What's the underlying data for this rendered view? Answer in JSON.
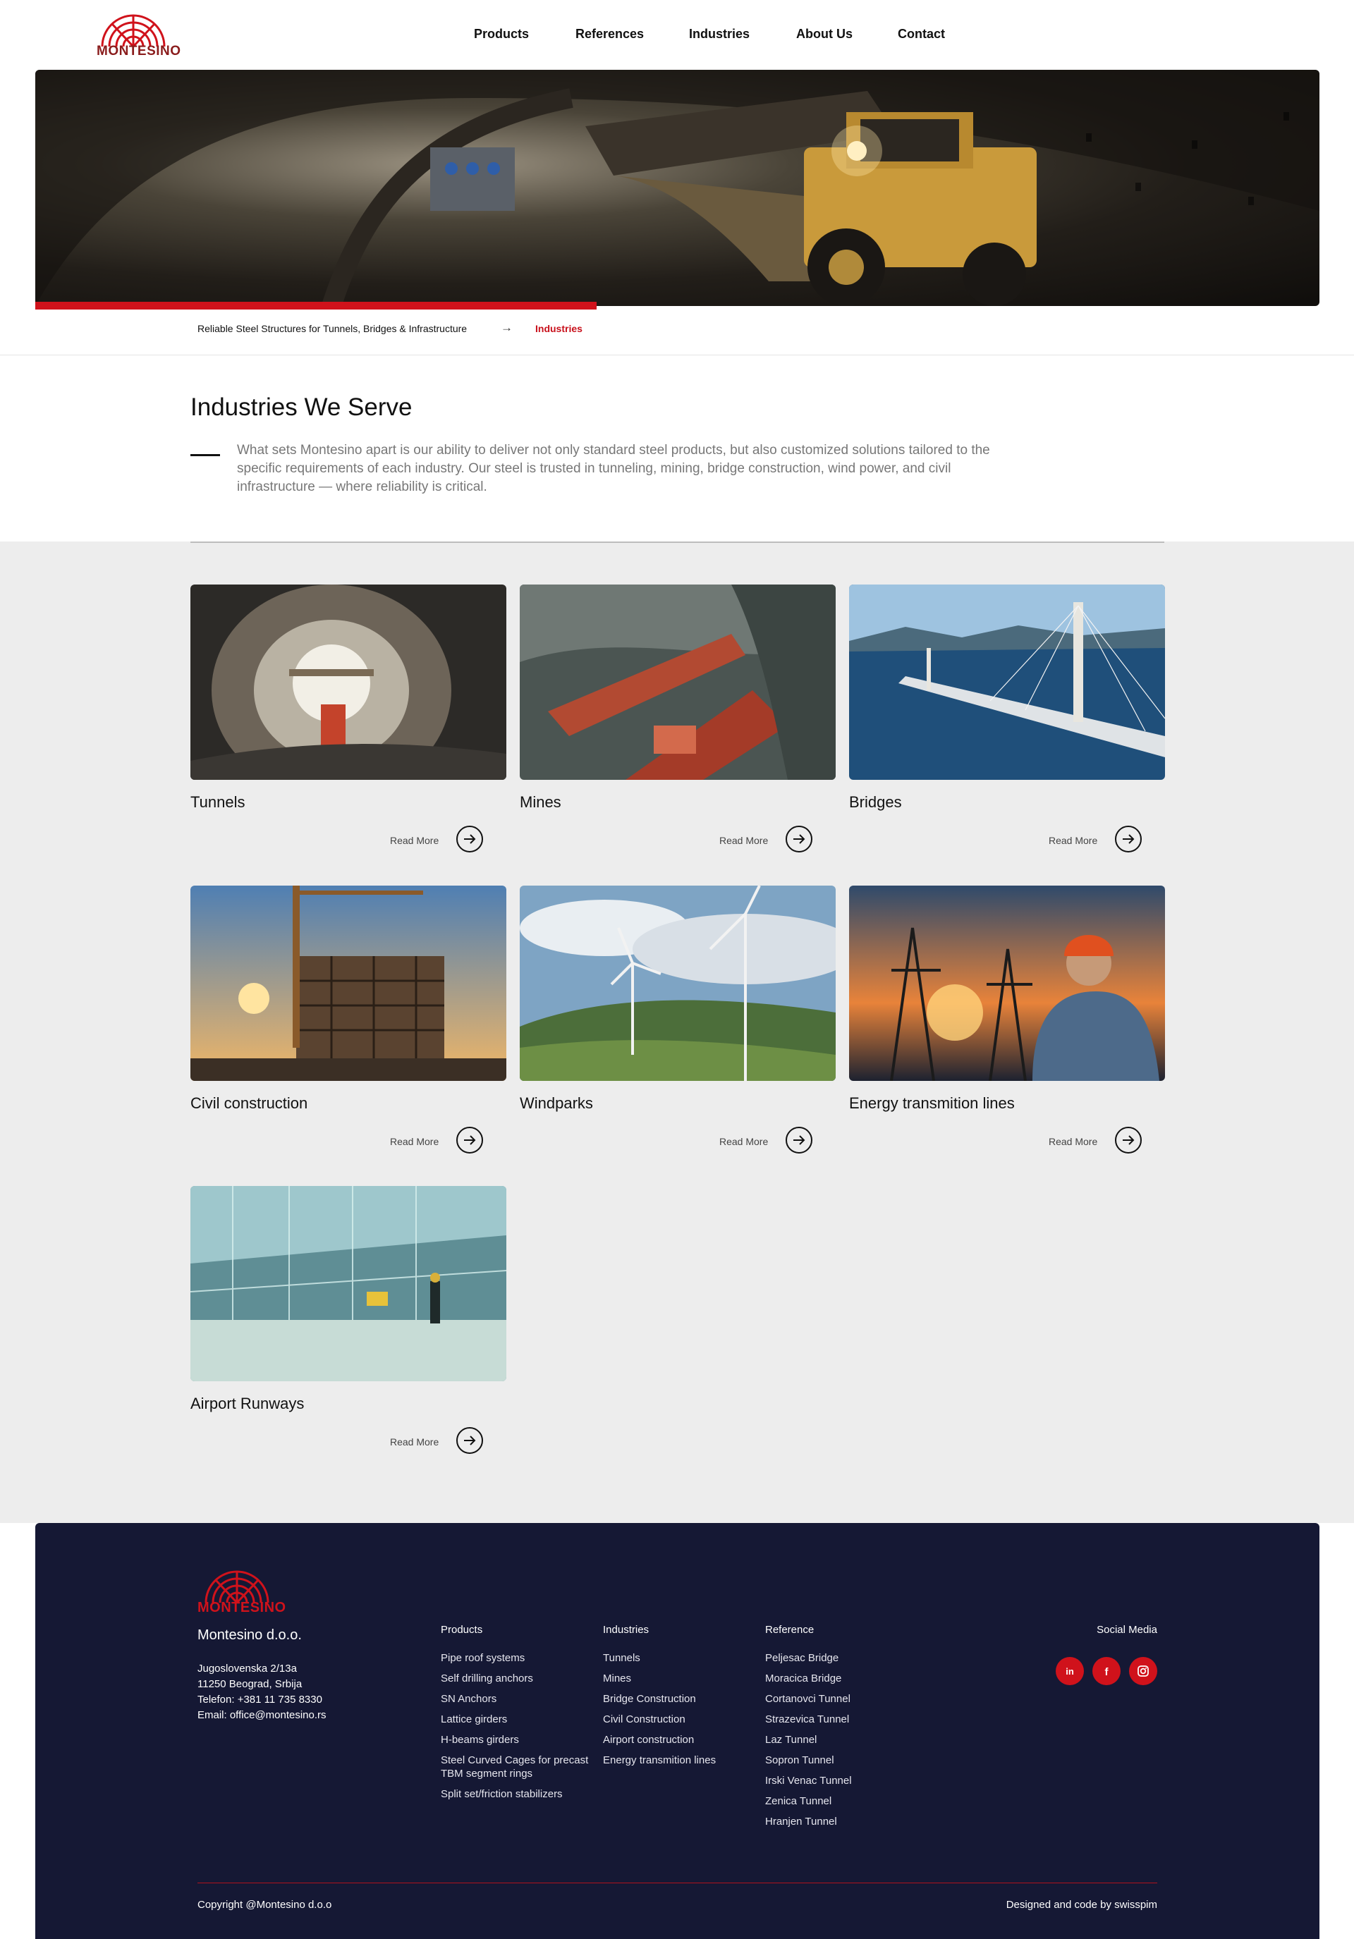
{
  "brand": {
    "name": "MONTESINO",
    "accent": "#d0121b",
    "footer_bg": "#151834",
    "section_bg": "#ededed"
  },
  "nav": {
    "items": [
      "Products",
      "References",
      "Industries",
      "About Us",
      "Contact"
    ]
  },
  "hero": {
    "slide_progress": 0.437
  },
  "breadcrumb": {
    "home": "Reliable Steel Structures for Tunnels, Bridges & Infrastructure",
    "current": "Industries"
  },
  "intro": {
    "title": "Industries We Serve",
    "text": "What sets Montesino apart is our ability to deliver not only standard steel products, but also customized solutions tailored to the specific requirements of each industry. Our steel is trusted in tunneling, mining, bridge construction, wind power, and civil infrastructure — where reliability is critical."
  },
  "industries": [
    {
      "title": "Tunnels",
      "read_more": "Read More",
      "image": "tunnel-photo"
    },
    {
      "title": "Mines",
      "read_more": "Read More",
      "image": "mine-drill-photo"
    },
    {
      "title": "Bridges",
      "read_more": "Read More",
      "image": "bridge-photo"
    },
    {
      "title": "Civil construction",
      "read_more": "Read More",
      "image": "construction-site-photo"
    },
    {
      "title": "Windparks",
      "read_more": "Read More",
      "image": "wind-turbines-photo"
    },
    {
      "title": "Energy transmition lines",
      "read_more": "Read More",
      "image": "power-lines-photo"
    },
    {
      "title": "Airport Runways",
      "read_more": "Read More",
      "image": "airport-terminal-photo"
    }
  ],
  "footer": {
    "logo_text": "MONTESINO",
    "company": "Montesino d.o.o.",
    "address": [
      "Jugoslovenska 2/13a",
      "11250 Beograd, Srbija",
      "Telefon: +381 11 735 8330",
      "Email: office@montesino.rs"
    ],
    "columns": [
      {
        "title": "Products",
        "items": [
          "Pipe roof systems",
          "Self drilling anchors",
          "SN Anchors",
          "Lattice girders",
          "H-beams girders",
          "Steel Curved Cages for precast TBM segment rings",
          "Split set/friction stabilizers"
        ]
      },
      {
        "title": "Industries",
        "items": [
          "Tunnels",
          "Mines",
          "Bridge Construction",
          "Civil Construction",
          "Airport construction",
          "Energy transmition lines"
        ]
      },
      {
        "title": "Reference",
        "items": [
          "Peljesac Bridge",
          "Moracica Bridge",
          "Cortanovci Tunnel",
          "Strazevica Tunnel",
          "Laz Tunnel",
          "Sopron Tunnel",
          "Irski Venac Tunnel",
          "Zenica Tunnel",
          "Hranjen Tunnel"
        ]
      }
    ],
    "social_title": "Social Media",
    "social": [
      "linkedin-icon",
      "facebook-icon",
      "instagram-icon"
    ],
    "copyright": "Copyright @Montesino d.o.o",
    "designed": "Designed and code by swisspim"
  }
}
